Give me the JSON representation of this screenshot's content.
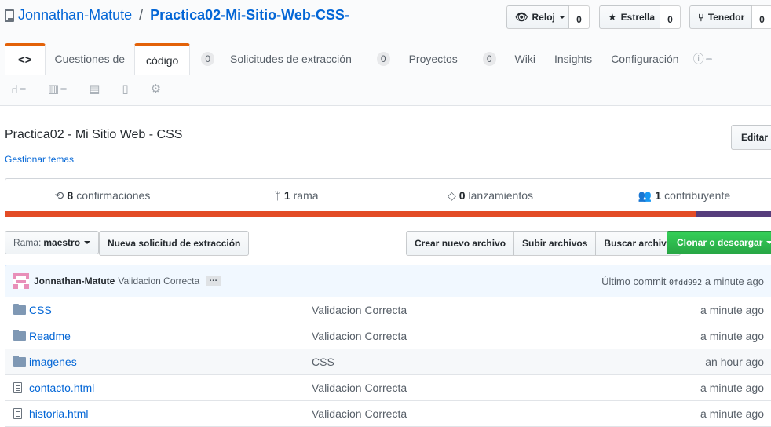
{
  "repo": {
    "owner": "Jonnathan-Matute",
    "separator": "/",
    "name": "Practica02-Mi-Sitio-Web-CSS-"
  },
  "social": {
    "watch_label": "Reloj",
    "watch_count": "0",
    "star_label": "Estrella",
    "star_count": "0",
    "fork_label": "Tenedor",
    "fork_count": "0"
  },
  "tabs": [
    {
      "label": "<>"
    },
    {
      "label": "Cuestiones de"
    },
    {
      "label": "código"
    },
    {
      "label": "Solicitudes de extracción",
      "count": "0"
    },
    {
      "label": "Proyectos",
      "count": "0"
    },
    {
      "label": "Wiki",
      "count": "0"
    },
    {
      "label": "Insights"
    },
    {
      "label": "Configuración"
    }
  ],
  "issues_count": "0",
  "repo_description": "Practica02 - Mi Sitio Web - CSS",
  "manage_topics": "Gestionar temas",
  "edit_label": "Editar",
  "summary": {
    "commits_num": "8",
    "commits_label": "confirmaciones",
    "branches_num": "1",
    "branches_label": "rama",
    "releases_num": "0",
    "releases_label": "lanzamientos",
    "contributors_num": "1",
    "contributors_label": "contribuyente"
  },
  "language_colors": {
    "css": "#e34c26",
    "other": "#563d7c"
  },
  "language_share": {
    "css": 0.89,
    "other": 0.11
  },
  "branch": {
    "label": "Rama:",
    "value": "maestro"
  },
  "buttons": {
    "new_pr": "Nueva solicitud de extracción",
    "create_file": "Crear nuevo archivo",
    "upload": "Subir archivos",
    "find": "Buscar archivo",
    "clone": "Clonar o descargar"
  },
  "commit": {
    "author": "Jonnathan-Matute",
    "message": "Validacion Correcta",
    "more": "…",
    "last_commit_label": "Último commit",
    "sha": "0fdd992",
    "age": "a minute ago"
  },
  "files": [
    {
      "type": "dir",
      "name": "CSS",
      "message": "Validacion Correcta",
      "age": "a minute ago",
      "icon": "folder-icon"
    },
    {
      "type": "dir",
      "name": "Readme",
      "message": "Validacion Correcta",
      "age": "a minute ago",
      "icon": "folder-icon"
    },
    {
      "type": "dir",
      "name": "imagenes",
      "message": "CSS",
      "age": "an hour ago",
      "icon": "folder-icon"
    },
    {
      "type": "file",
      "name": "contacto.html",
      "message": "Validacion Correcta",
      "age": "a minute ago",
      "icon": "file-icon"
    },
    {
      "type": "file",
      "name": "historia.html",
      "message": "Validacion Correcta",
      "age": "a minute ago",
      "icon": "file-icon"
    }
  ]
}
